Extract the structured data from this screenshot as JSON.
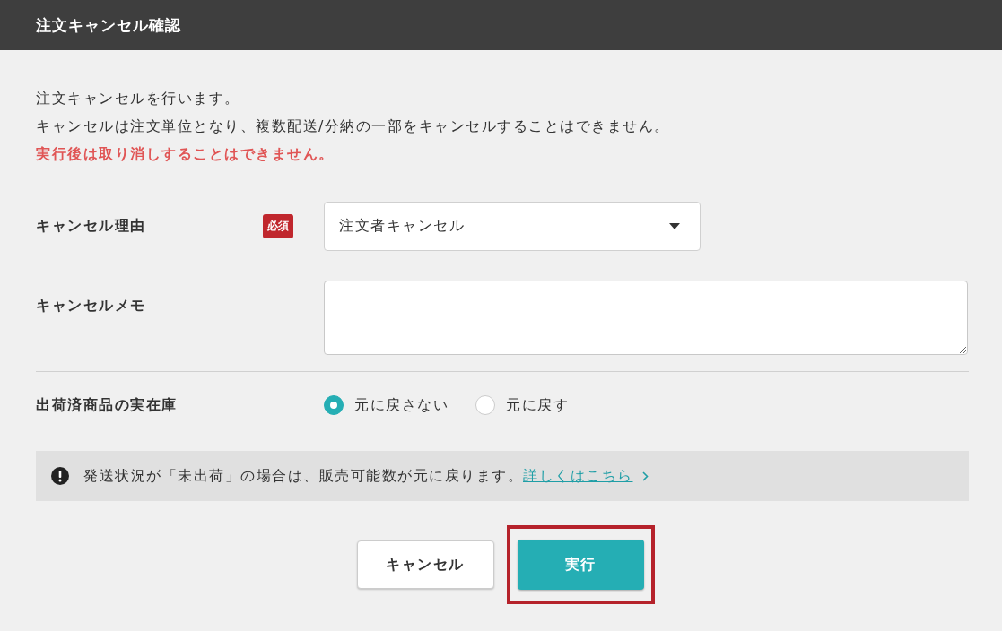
{
  "window": {
    "title": "注文キャンセル確認"
  },
  "intro": [
    "注文キャンセルを行います。",
    "キャンセルは注文単位となり、複数配送/分納の一部をキャンセルすることはできません。"
  ],
  "warning": "実行後は取り消しすることはできません。",
  "form": [
    {
      "kind": "select",
      "label": "キャンセル理由",
      "required_badge": "必須",
      "value": "注文者キャンセル"
    },
    {
      "kind": "textarea",
      "label": "キャンセルメモ"
    },
    {
      "kind": "radio",
      "label": "出荷済商品の実在庫",
      "options": [
        {
          "label": "元に戻さない",
          "selected": true
        },
        {
          "label": "元に戻す",
          "selected": false
        }
      ]
    }
  ],
  "notice": {
    "text": "発送状況が「未出荷」の場合は、販売可能数が元に戻ります。",
    "link": "詳しくはこちら"
  },
  "buttons": [
    {
      "kind": "secondary",
      "label": "キャンセル",
      "highlighted": false
    },
    {
      "kind": "primary",
      "label": "実行",
      "highlighted": true
    }
  ]
}
